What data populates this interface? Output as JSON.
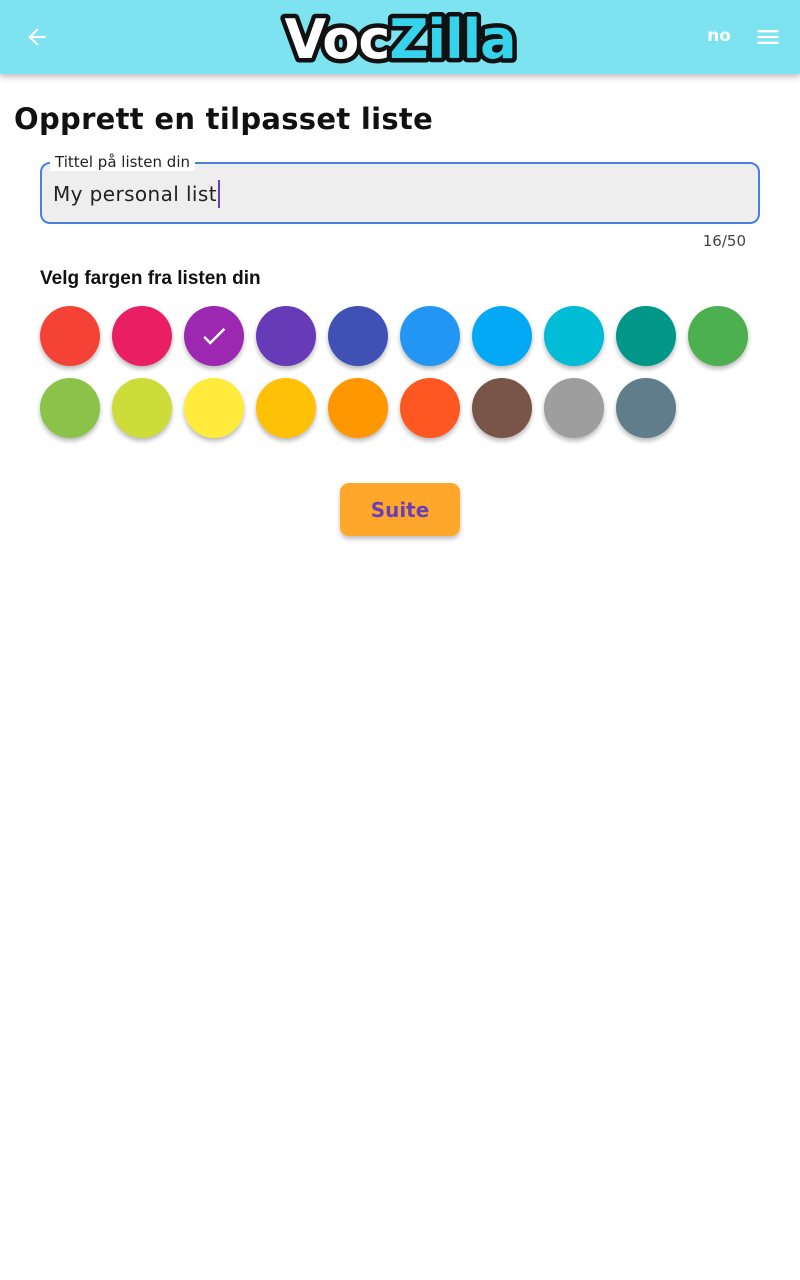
{
  "header": {
    "back_icon": "arrow-left-icon",
    "logo_text_dark": "Voc",
    "logo_text_accent": "Zilla",
    "language": "no",
    "menu_icon": "hamburger-menu-icon",
    "background_color": "#7de3f0"
  },
  "page": {
    "title": "Opprett en tilpasset liste"
  },
  "title_field": {
    "label": "Tittel på listen din",
    "value": "My personal list",
    "counter": "16/50",
    "max_length": 50,
    "border_color": "#4a7fe0"
  },
  "color_picker": {
    "heading": "Velg fargen fra listen din",
    "selected_index": 2,
    "check_icon": "check-icon",
    "colors": [
      "#f44336",
      "#e91e63",
      "#9c27b0",
      "#673ab7",
      "#3f51b5",
      "#2196f3",
      "#03a9f4",
      "#00bcd4",
      "#009688",
      "#4caf50",
      "#8bc34a",
      "#cddc39",
      "#ffeb3b",
      "#ffc107",
      "#ff9800",
      "#ff5722",
      "#795548",
      "#9e9e9e",
      "#607d8b"
    ]
  },
  "actions": {
    "continue_label": "Suite",
    "continue_color": "#ffa72a"
  }
}
